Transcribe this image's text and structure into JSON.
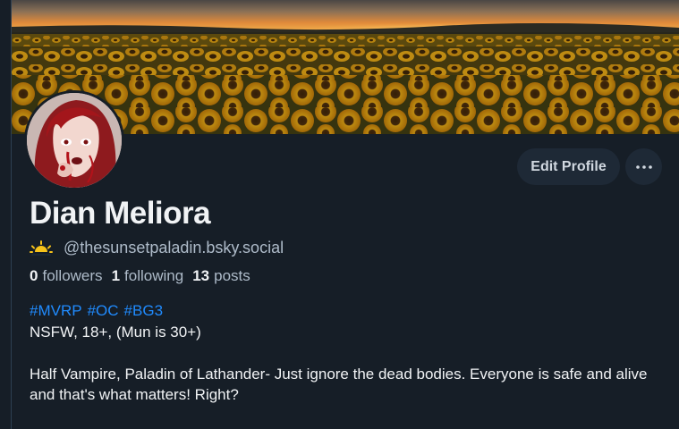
{
  "profile": {
    "display_name": "Dian Meliora",
    "handle": "@thesunsetpaladin.bsky.social",
    "handle_emoji_icon": "sunset-emoji-icon",
    "stats": {
      "followers_count": "0",
      "followers_label": "followers",
      "following_count": "1",
      "following_label": "following",
      "posts_count": "13",
      "posts_label": "posts"
    },
    "bio": {
      "tags": [
        "#MVRP",
        "#OC",
        "#BG3"
      ],
      "line1": "NSFW, 18+, (Mun is 30+)",
      "paragraph": "Half Vampire, Paladin of Lathander- Just ignore the dead bodies. Everyone is safe and alive and that's what matters! Right?"
    }
  },
  "actions": {
    "edit_profile_label": "Edit Profile",
    "more_icon": "ellipsis-icon"
  },
  "colors": {
    "background": "#161e27",
    "button_bg": "#1e2936",
    "link": "#208bfe",
    "muted_text": "#aebbc9",
    "primary_text": "#f1f3f5"
  }
}
